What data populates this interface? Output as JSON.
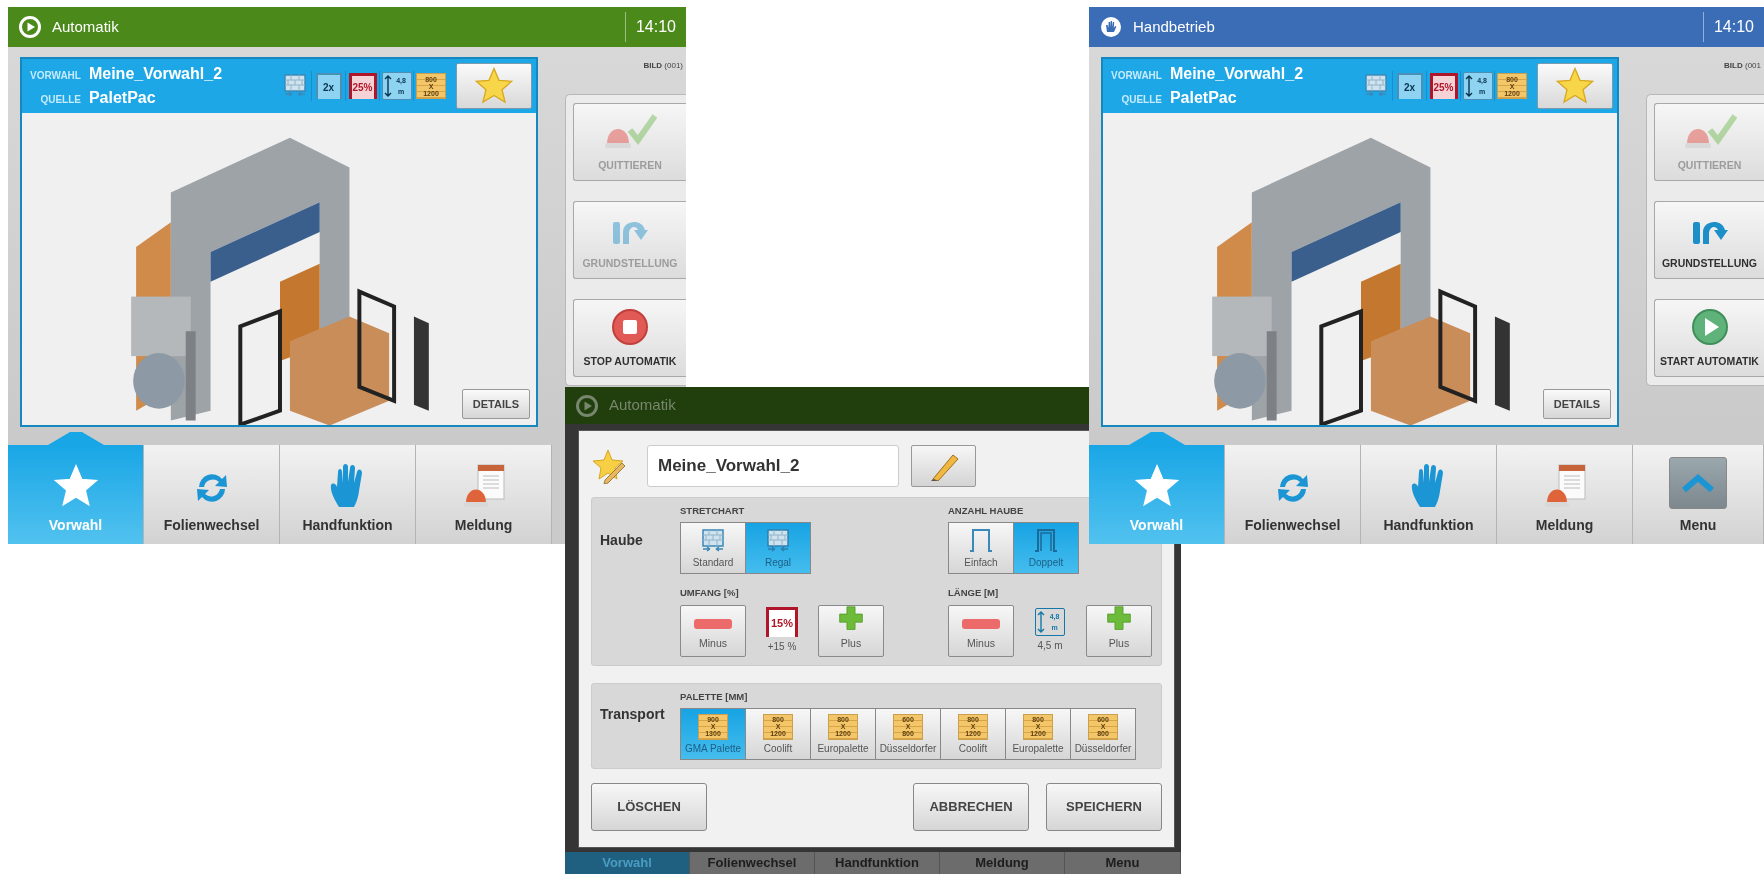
{
  "windows": [
    {
      "kind": "main",
      "header": {
        "title": "Automatik",
        "kind": "automatic",
        "color": "#4b8a1a",
        "time": "14:10"
      },
      "image_ref": "**BILD** (001)",
      "selection": {
        "vorwahl_label": "VORWAHL",
        "vorwahl": "Meine_Vorwahl_2",
        "quelle_label": "QUELLE",
        "quelle": "PaletPac"
      },
      "status_icons": [
        {
          "kind": "stretch",
          "active": true
        },
        {
          "kind": "hood",
          "text": "2x",
          "active": false
        },
        {
          "kind": "percent",
          "text": "25%",
          "active": true
        },
        {
          "kind": "length",
          "text": "4,8",
          "unit": "m",
          "active": false
        },
        {
          "kind": "pallet",
          "lines": [
            "800",
            "X",
            "1200"
          ],
          "active": true
        }
      ],
      "details_button": "DETAILS",
      "actions": [
        {
          "kind": "acknowledge",
          "label": "QUITTIEREN",
          "disabled": true
        },
        {
          "kind": "home",
          "label": "GRUNDSTELLUNG",
          "disabled": true
        },
        {
          "kind": "stop",
          "label": "STOP AUTOMATIK",
          "disabled": false
        }
      ],
      "nav": [
        {
          "kind": "favorites",
          "label": "Vorwahl",
          "selected": true
        },
        {
          "kind": "refresh",
          "label": "Folienwechsel",
          "selected": false
        },
        {
          "kind": "manual",
          "label": "Handfunktion",
          "selected": false
        },
        {
          "kind": "messages",
          "label": "Meldung",
          "selected": false
        }
      ]
    },
    {
      "kind": "dialog",
      "header": {
        "title": "Automatik",
        "kind": "automatic",
        "color": "#213e0d"
      },
      "name_field": {
        "value": "Meine_Vorwahl_2"
      },
      "sections": [
        {
          "label": "Haube",
          "groups": [
            {
              "kind": "segmented",
              "title": "STRETCHART",
              "options": [
                {
                  "kind": "wall-standard",
                  "label": "Standard",
                  "selected": false
                },
                {
                  "kind": "wall-shelf",
                  "label": "Regal",
                  "selected": true
                }
              ]
            },
            {
              "kind": "segmented",
              "title": "ANZAHL HAUBE",
              "options": [
                {
                  "kind": "hood-single",
                  "label": "Einfach",
                  "selected": false
                },
                {
                  "kind": "hood-double",
                  "label": "Doppelt",
                  "selected": true
                }
              ]
            },
            {
              "kind": "stepper",
              "title": "UMFANG [%]",
              "minus": "Minus",
              "plus": "Plus",
              "badge": {
                "kind": "percent",
                "text": "15%"
              },
              "reading": "+15 %"
            },
            {
              "kind": "stepper",
              "title": "LÄNGE [M]",
              "minus": "Minus",
              "plus": "Plus",
              "badge": {
                "kind": "length",
                "text": "4,8",
                "unit": "m"
              },
              "reading": "4,5 m"
            }
          ]
        },
        {
          "label": "Transport",
          "groups": [
            {
              "kind": "segmented",
              "title": "PALETTE [MM]",
              "options": [
                {
                  "kind": "pallet",
                  "lines": [
                    "900",
                    "X",
                    "1300"
                  ],
                  "label": "GMA Palette",
                  "selected": true
                },
                {
                  "kind": "pallet",
                  "lines": [
                    "800",
                    "X",
                    "1200"
                  ],
                  "label": "Coolift",
                  "selected": false
                },
                {
                  "kind": "pallet",
                  "lines": [
                    "800",
                    "X",
                    "1200"
                  ],
                  "label": "Europalette",
                  "selected": false
                },
                {
                  "kind": "pallet",
                  "lines": [
                    "600",
                    "X",
                    "800"
                  ],
                  "label": "Düsseldorfer",
                  "selected": false
                },
                {
                  "kind": "pallet",
                  "lines": [
                    "800",
                    "X",
                    "1200"
                  ],
                  "label": "Coolift",
                  "selected": false
                },
                {
                  "kind": "pallet",
                  "lines": [
                    "800",
                    "X",
                    "1200"
                  ],
                  "label": "Europalette",
                  "selected": false
                },
                {
                  "kind": "pallet",
                  "lines": [
                    "600",
                    "X",
                    "800"
                  ],
                  "label": "Düsseldorfer",
                  "selected": false
                }
              ]
            }
          ]
        }
      ],
      "buttons": [
        {
          "kind": "delete",
          "label": "LÖSCHEN"
        },
        {
          "kind": "cancel",
          "label": "ABBRECHEN"
        },
        {
          "kind": "save",
          "label": "SPEICHERN"
        }
      ],
      "nav": [
        {
          "label": "Vorwahl",
          "selected": true
        },
        {
          "label": "Folienwechsel",
          "selected": false
        },
        {
          "label": "Handfunktion",
          "selected": false
        },
        {
          "label": "Meldung",
          "selected": false
        },
        {
          "label": "Menu",
          "selected": false
        }
      ]
    },
    {
      "kind": "main",
      "header": {
        "title": "Handbetrieb",
        "kind": "manual",
        "color": "#3a6db5",
        "time": "14:10"
      },
      "image_ref": "**BILD** (001",
      "selection": {
        "vorwahl_label": "VORWAHL",
        "vorwahl": "Meine_Vorwahl_2",
        "quelle_label": "QUELLE",
        "quelle": "PaletPac"
      },
      "status_icons": [
        {
          "kind": "stretch",
          "active": true
        },
        {
          "kind": "hood",
          "text": "2x",
          "active": false
        },
        {
          "kind": "percent",
          "text": "25%",
          "active": true
        },
        {
          "kind": "length",
          "text": "4,8",
          "unit": "m",
          "active": false
        },
        {
          "kind": "pallet",
          "lines": [
            "800",
            "X",
            "1200"
          ],
          "active": true
        }
      ],
      "details_button": "DETAILS",
      "actions": [
        {
          "kind": "acknowledge",
          "label": "QUITTIEREN",
          "disabled": true
        },
        {
          "kind": "home",
          "label": "GRUNDSTELLUNG",
          "disabled": false
        },
        {
          "kind": "start",
          "label": "START AUTOMATIK",
          "disabled": false
        }
      ],
      "nav": [
        {
          "kind": "favorites",
          "label": "Vorwahl",
          "selected": true
        },
        {
          "kind": "refresh",
          "label": "Folienwechsel",
          "selected": false
        },
        {
          "kind": "manual",
          "label": "Handfunktion",
          "selected": false
        },
        {
          "kind": "messages",
          "label": "Meldung",
          "selected": false
        },
        {
          "kind": "menu",
          "label": "Menu",
          "selected": false
        }
      ]
    }
  ]
}
